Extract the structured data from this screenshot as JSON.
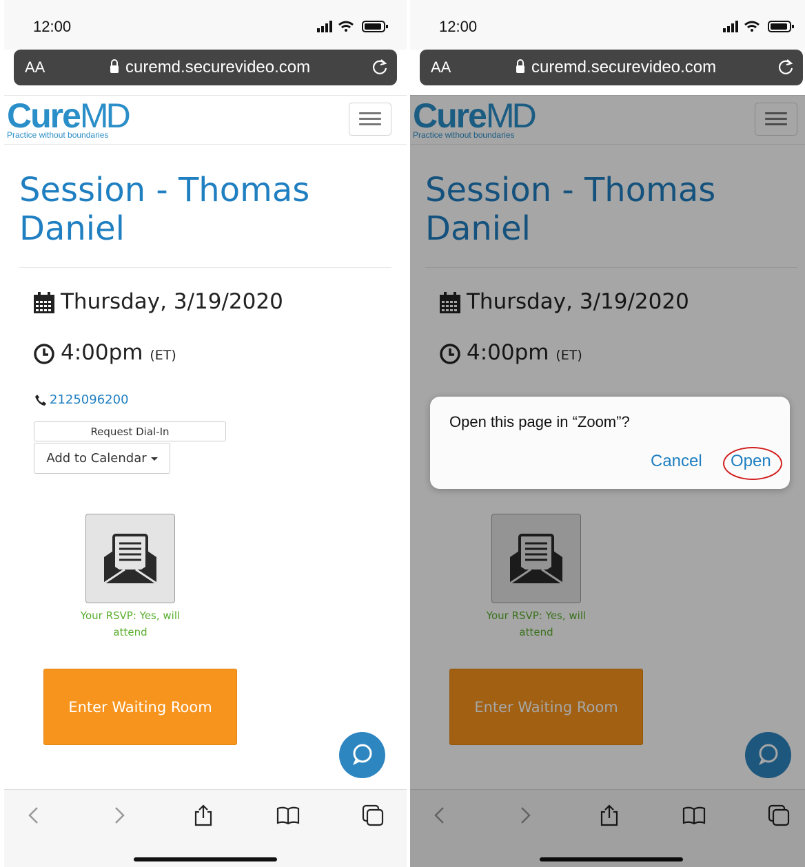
{
  "status_bar": {
    "time": "12:00"
  },
  "browser": {
    "text_size_label": "AA",
    "url": "curemd.securevideo.com"
  },
  "logo": {
    "brand_bold": "Cure",
    "brand_light": "MD",
    "tagline": "Practice without boundaries"
  },
  "session": {
    "title": "Session - Thomas Daniel",
    "date": "Thursday, 3/19/2020",
    "time": "4:00pm",
    "timezone": "(ET)",
    "phone": "2125096200",
    "request_dialin_label": "Request Dial-In",
    "add_to_calendar_label": "Add to Calendar",
    "rsvp_text": "Your RSVP: Yes, will attend",
    "enter_waiting_room_label": "Enter Waiting Room"
  },
  "dialog": {
    "message": "Open this page in “Zoom”?",
    "cancel_label": "Cancel",
    "open_label": "Open"
  },
  "colors": {
    "brand_blue": "#1f7fc1",
    "waiting_orange": "#f7941d",
    "rsvp_green": "#5aae2e",
    "highlight_red": "#d11d1d"
  },
  "icons": [
    "lock-icon",
    "reload-icon",
    "menu-icon",
    "calendar-icon",
    "clock-icon",
    "phone-icon",
    "envelope-icon",
    "chat-icon",
    "back-icon",
    "forward-icon",
    "share-icon",
    "bookmarks-icon",
    "tabs-icon"
  ]
}
